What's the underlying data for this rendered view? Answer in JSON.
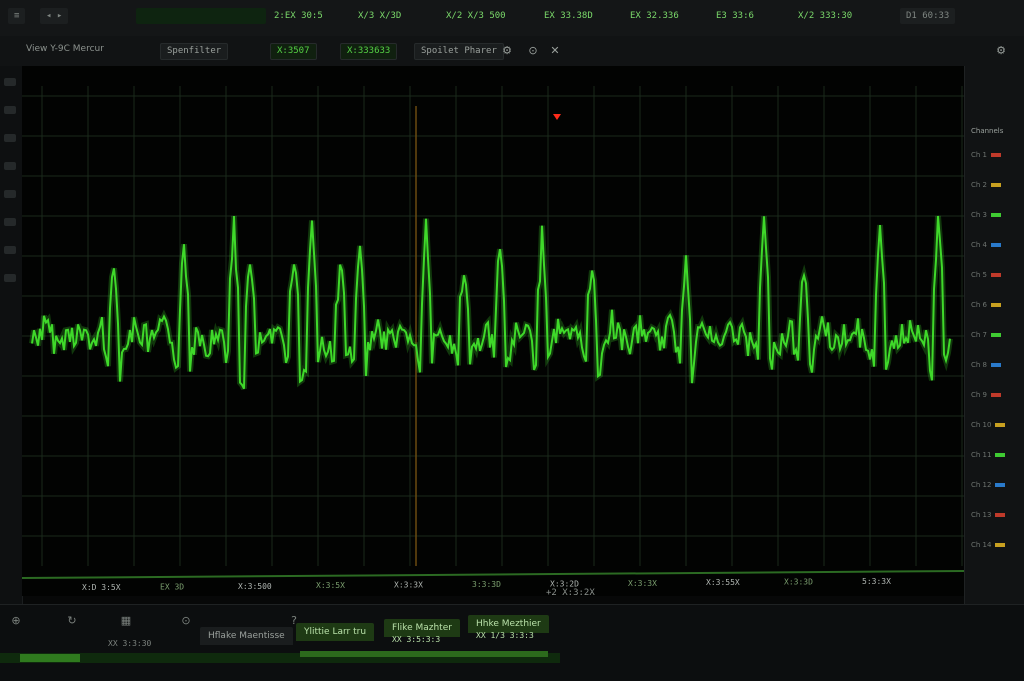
{
  "topbar": {
    "readouts": [
      "2:EX 30:5",
      "X/3 X/3D",
      "X/2 X/3 500",
      "EX 33.38D",
      "EX 32.336",
      "E3 33:6",
      "X/2 333:30",
      "D1 60:33"
    ]
  },
  "toolbar": {
    "view_label": "View Y-9C Mercur",
    "chips": [
      "Spenfilter",
      "X:3507",
      "X:333633",
      "Spoilet Pharer"
    ],
    "icons": [
      "settings-icon",
      "link-icon",
      "close-icon"
    ]
  },
  "scope": {
    "marker_label": "+2 X:3:2X",
    "bottom_readouts": [
      "X:D 3:5X",
      "EX 3D",
      "X:3:500",
      "X:3:5X",
      "X:3:3X",
      "3:3:3D",
      "X:3:2D",
      "X:3:3X",
      "X:3:55X",
      "X:3:3D",
      "5:3:3X"
    ],
    "colors": {
      "trace": "#3fd92a",
      "grid": "#1a2a1b",
      "cursor": "#6a4a10",
      "marker": "#ff2b1a"
    }
  },
  "right_panel": {
    "header": "Channels",
    "rows": [
      "Ch 1",
      "Ch 2",
      "Ch 3",
      "Ch 4",
      "Ch 5",
      "Ch 6",
      "Ch 7",
      "Ch 8",
      "Ch 9",
      "Ch 10",
      "Ch 11",
      "Ch 12",
      "Ch 13",
      "Ch 14"
    ]
  },
  "footer": {
    "tabs": [
      "Hflake Maentisse",
      "Ylittie Larr tru",
      "Flike Mazhter",
      "Hhke Mezthier"
    ],
    "status": [
      "XX 3:3:30",
      "XX 3:5:3:3",
      "XX 1/3 3:3:3"
    ]
  }
}
